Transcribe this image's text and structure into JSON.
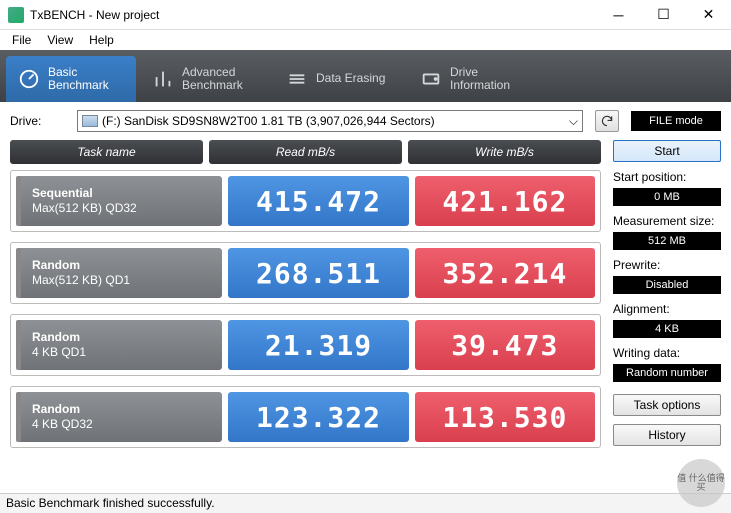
{
  "window": {
    "title": "TxBENCH - New project"
  },
  "menu": {
    "file": "File",
    "view": "View",
    "help": "Help"
  },
  "tabs": [
    {
      "line1": "Basic",
      "line2": "Benchmark"
    },
    {
      "line1": "Advanced",
      "line2": "Benchmark"
    },
    {
      "line1": "Data Erasing",
      "line2": ""
    },
    {
      "line1": "Drive",
      "line2": "Information"
    }
  ],
  "drive": {
    "label": "Drive:",
    "selected": "(F:) SanDisk SD9SN8W2T00   1.81 TB (3,907,026,944 Sectors)",
    "file_mode": "FILE mode"
  },
  "headers": {
    "task": "Task name",
    "read": "Read mB/s",
    "write": "Write mB/s"
  },
  "rows": [
    {
      "t1": "Sequential",
      "t2": "Max(512 KB) QD32",
      "read": "415.472",
      "write": "421.162"
    },
    {
      "t1": "Random",
      "t2": "Max(512 KB) QD1",
      "read": "268.511",
      "write": "352.214"
    },
    {
      "t1": "Random",
      "t2": "4 KB QD1",
      "read": "21.319",
      "write": "39.473"
    },
    {
      "t1": "Random",
      "t2": "4 KB QD32",
      "read": "123.322",
      "write": "113.530"
    }
  ],
  "side": {
    "start": "Start",
    "start_pos_label": "Start position:",
    "start_pos": "0 MB",
    "meas_label": "Measurement size:",
    "meas": "512 MB",
    "prewrite_label": "Prewrite:",
    "prewrite": "Disabled",
    "align_label": "Alignment:",
    "align": "4 KB",
    "wdata_label": "Writing data:",
    "wdata": "Random number",
    "task_options": "Task options",
    "history": "History"
  },
  "status": "Basic Benchmark finished successfully.",
  "watermark": "值 什么值得买",
  "chart_data": {
    "type": "table",
    "title": "TxBENCH Basic Benchmark",
    "columns": [
      "Task name",
      "Read mB/s",
      "Write mB/s"
    ],
    "rows": [
      [
        "Sequential Max(512 KB) QD32",
        415.472,
        421.162
      ],
      [
        "Random Max(512 KB) QD1",
        268.511,
        352.214
      ],
      [
        "Random 4 KB QD1",
        21.319,
        39.473
      ],
      [
        "Random 4 KB QD32",
        123.322,
        113.53
      ]
    ]
  }
}
